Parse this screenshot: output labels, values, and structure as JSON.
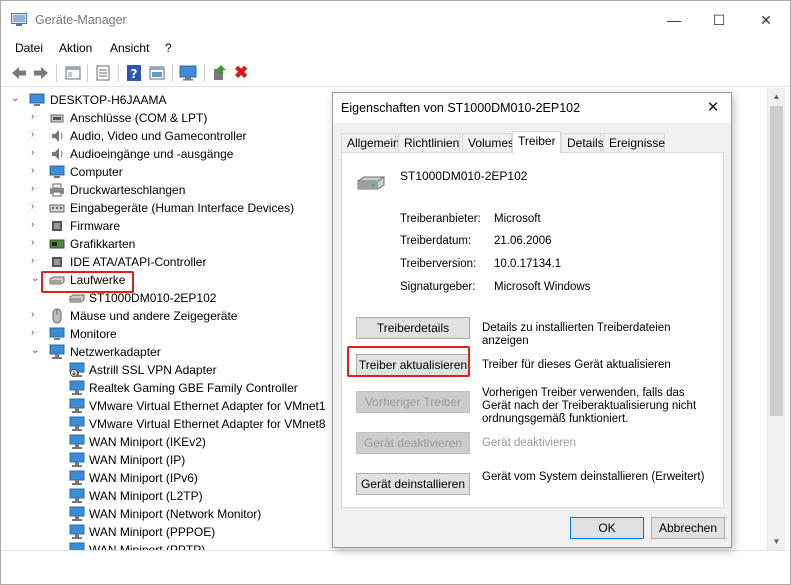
{
  "window": {
    "title": "Geräte-Manager",
    "minimize_glyph": "—",
    "maximize_glyph": "☐",
    "close_glyph": "✕"
  },
  "menu": [
    "Datei",
    "Aktion",
    "Ansicht",
    "?"
  ],
  "toolbar": {
    "icons": [
      "back-icon",
      "forward-icon",
      "properties-icon",
      "console-tree-icon",
      "help-icon",
      "view-icon",
      "monitor-icon",
      "update-driver-icon",
      "uninstall-icon"
    ],
    "uninstall_glyph": "✖"
  },
  "tree": {
    "root": "DESKTOP-H6JAAMA",
    "items": [
      {
        "label": "Anschlüsse (COM & LPT)",
        "expanded": false
      },
      {
        "label": "Audio, Video und Gamecontroller",
        "expanded": false
      },
      {
        "label": "Audioeingänge und -ausgänge",
        "expanded": false
      },
      {
        "label": "Computer",
        "expanded": false
      },
      {
        "label": "Druckwarteschlangen",
        "expanded": false
      },
      {
        "label": "Eingabegeräte (Human Interface Devices)",
        "expanded": false
      },
      {
        "label": "Firmware",
        "expanded": false
      },
      {
        "label": "Grafikkarten",
        "expanded": false
      },
      {
        "label": "IDE ATA/ATAPI-Controller",
        "expanded": false
      },
      {
        "label": "Laufwerke",
        "expanded": true,
        "highlighted": true
      },
      {
        "label": "ST1000DM010-2EP102",
        "child": true
      },
      {
        "label": "Mäuse und andere Zeigegeräte",
        "expanded": false
      },
      {
        "label": "Monitore",
        "expanded": false
      },
      {
        "label": "Netzwerkadapter",
        "expanded": true
      },
      {
        "label": "Astrill SSL VPN Adapter",
        "child": true
      },
      {
        "label": "Realtek Gaming GBE Family Controller",
        "child": true
      },
      {
        "label": "VMware Virtual Ethernet Adapter for VMnet1",
        "child": true
      },
      {
        "label": "VMware Virtual Ethernet Adapter for VMnet8",
        "child": true
      },
      {
        "label": "WAN Miniport (IKEv2)",
        "child": true
      },
      {
        "label": "WAN Miniport (IP)",
        "child": true
      },
      {
        "label": "WAN Miniport (IPv6)",
        "child": true
      },
      {
        "label": "WAN Miniport (L2TP)",
        "child": true
      },
      {
        "label": "WAN Miniport (Network Monitor)",
        "child": true
      },
      {
        "label": "WAN Miniport (PPPOE)",
        "child": true
      },
      {
        "label": "WAN Miniport (PPTP)",
        "child": true
      }
    ]
  },
  "dialog": {
    "title": "Eigenschaften von ST1000DM010-2EP102",
    "close_glyph": "✕",
    "tabs": [
      "Allgemein",
      "Richtlinien",
      "Volumes",
      "Treiber",
      "Details",
      "Ereignisse"
    ],
    "active_tab": "Treiber",
    "device_name": "ST1000DM010-2EP102",
    "properties": [
      {
        "label": "Treiberanbieter:",
        "value": "Microsoft"
      },
      {
        "label": "Treiberdatum:",
        "value": "21.06.2006"
      },
      {
        "label": "Treiberversion:",
        "value": "10.0.17134.1"
      },
      {
        "label": "Signaturgeber:",
        "value": "Microsoft Windows"
      }
    ],
    "buttons": [
      {
        "label": "Treiberdetails",
        "desc": "Details zu installierten Treiberdateien anzeigen",
        "enabled": true
      },
      {
        "label": "Treiber aktualisieren",
        "desc": "Treiber für dieses Gerät aktualisieren",
        "enabled": true,
        "highlighted": true
      },
      {
        "label": "Vorheriger Treiber",
        "desc": "Vorherigen Treiber verwenden, falls das Gerät nach der Treiberaktualisierung nicht ordnungsgemäß funktioniert.",
        "enabled": false
      },
      {
        "label": "Gerät deaktivieren",
        "desc": "Gerät deaktivieren",
        "enabled": false
      },
      {
        "label": "Gerät deinstallieren",
        "desc": "Gerät vom System deinstallieren (Erweitert)",
        "enabled": true
      }
    ],
    "ok_label": "OK",
    "cancel_label": "Abbrechen"
  },
  "colors": {
    "highlight": "#e02020",
    "accent": "#0078d7"
  }
}
